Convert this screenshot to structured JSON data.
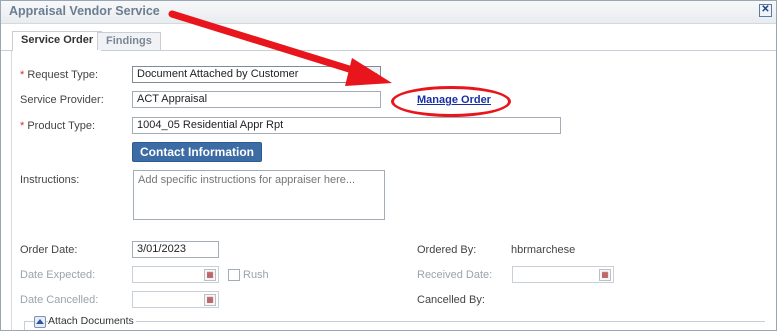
{
  "window": {
    "title": "Appraisal Vendor Service",
    "close_glyph": "✕"
  },
  "tabs": [
    {
      "label": "Service Order",
      "active": true
    },
    {
      "label": "Findings",
      "active": false
    }
  ],
  "form": {
    "request_type": {
      "required_mark": "*",
      "label": "Request Type:",
      "value": "Document Attached by Customer"
    },
    "service_provider": {
      "label": "Service Provider:",
      "value": "ACT Appraisal"
    },
    "manage_order_link": "Manage Order",
    "product_type": {
      "required_mark": "*",
      "label": "Product Type:",
      "value": "1004_05 Residential Appr Rpt"
    },
    "contact_button": "Contact Information",
    "instructions": {
      "label": "Instructions:",
      "placeholder": "Add specific instructions for appraiser here..."
    },
    "order_date": {
      "label": "Order Date:",
      "value": "3/01/2023"
    },
    "ordered_by": {
      "label": "Ordered By:",
      "value": "hbrmarchese"
    },
    "date_expected": {
      "label": "Date Expected:",
      "value": ""
    },
    "rush": {
      "label": "Rush",
      "checked": false
    },
    "received_date": {
      "label": "Received Date:",
      "value": ""
    },
    "date_cancelled": {
      "label": "Date Cancelled:",
      "value": ""
    },
    "cancelled_by": {
      "label": "Cancelled By:",
      "value": ""
    },
    "attach_documents": "Attach Documents"
  },
  "annotation": {
    "arrow_color": "#e8151d",
    "highlight_color": "#e8151d"
  }
}
